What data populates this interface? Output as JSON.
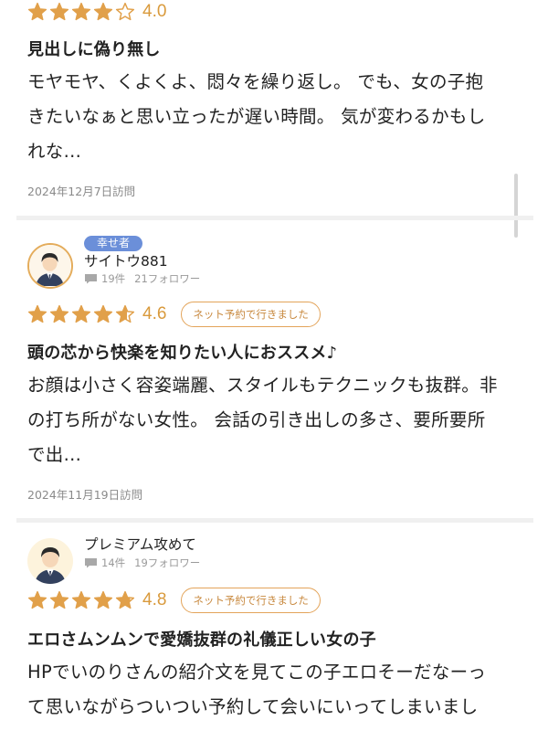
{
  "reviews": [
    {
      "score": "4.0",
      "stars": 4.0,
      "title": "見出しに偽り無し",
      "body_lines": [
        "モヤモヤ、くよくよ、悶々を繰り返し。 でも、女の子抱",
        "きたいなぁと思い立ったが遅い時間。 気が変わるかもし",
        "れな..."
      ],
      "date": "2024年12月7日訪問"
    },
    {
      "user_tag": "幸せ者",
      "username": "サイトウ881",
      "review_count": "19件",
      "followers": "21フォロワー",
      "score": "4.6",
      "stars": 4.6,
      "badge": "ネット予約で行きました",
      "title": "頭の芯から快楽を知りたい人におススメ♪",
      "body_lines": [
        "お顔は小さく容姿端麗、スタイルもテクニックも抜群。非",
        "の打ち所がない女性。 会話の引き出しの多さ、要所要所",
        "で出..."
      ],
      "date": "2024年11月19日訪問"
    },
    {
      "username": "プレミアム攻めて",
      "review_count": "14件",
      "followers": "19フォロワー",
      "score": "4.8",
      "stars": 4.8,
      "badge": "ネット予約で行きました",
      "title": "エロさムンムンで愛嬌抜群の礼儀正しい女の子",
      "body_lines": [
        "HPでいのりさんの紹介文を見てこの子エロそーだなーっ",
        "て思いながらついつい予約して会いにいってしまいまし"
      ]
    }
  ],
  "colors": {
    "star": "#e1a04a",
    "star_empty": "#d99a3c",
    "score": "#d99a3c",
    "badge_border": "#e3a45a",
    "tag_bg": "#6b8fd9",
    "avatar_ring": "#e4ac5b"
  },
  "icons": {
    "star": "star-icon",
    "chat": "speech-bubble-icon",
    "avatar": "user-avatar-illustration"
  }
}
